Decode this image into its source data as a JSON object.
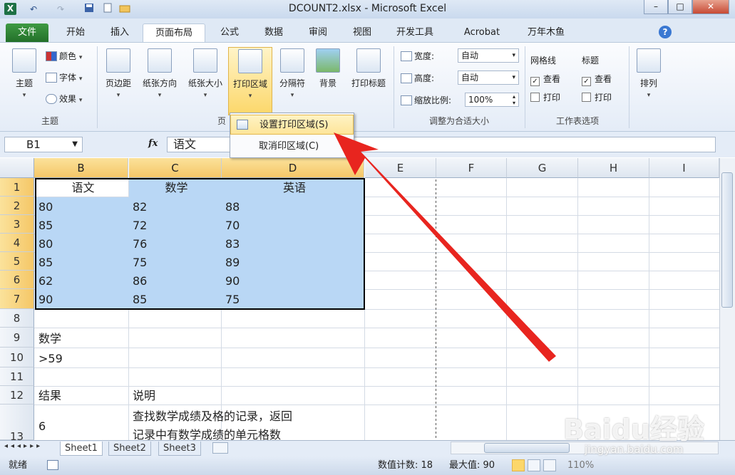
{
  "window": {
    "title": "DCOUNT2.xlsx - Microsoft Excel",
    "min": "–",
    "max": "□",
    "close": "✕"
  },
  "qat": {
    "app_icon": "X",
    "undo": "↶",
    "redo": "↷",
    "save": "💾",
    "new": "📄",
    "open": "📂"
  },
  "tabs": [
    "文件",
    "开始",
    "插入",
    "页面布局",
    "公式",
    "数据",
    "审阅",
    "视图",
    "开发工具",
    "Acrobat",
    "万年木鱼"
  ],
  "ribbon": {
    "theme": {
      "main": "主题",
      "colors": "颜色",
      "fonts": "字体",
      "effects": "效果",
      "group": "主题"
    },
    "page_setup": {
      "margins": "页边距",
      "orientation": "纸张方向",
      "size": "纸张大小",
      "print_area": "打印区域",
      "breaks": "分隔符",
      "background": "背景",
      "print_titles": "打印标题",
      "group": "页"
    },
    "scale": {
      "width_label": "宽度:",
      "width_value": "自动",
      "height_label": "高度:",
      "height_value": "自动",
      "scale_label": "缩放比例:",
      "scale_value": "100%",
      "group": "调整为合适大小"
    },
    "sheet_options": {
      "gridlines": "网格线",
      "headings": "标题",
      "view": "查看",
      "print": "打印",
      "group": "工作表选项"
    },
    "arrange": {
      "label": "排列"
    }
  },
  "menu": {
    "set_print_area": "设置打印区域(S)",
    "clear_print_area": "取消印区域(C)"
  },
  "formula_bar": {
    "name_box": "B1",
    "fx": "fx",
    "content": "语文"
  },
  "columns": [
    "B",
    "C",
    "D",
    "E",
    "F",
    "G",
    "H",
    "I"
  ],
  "rows": [
    "1",
    "2",
    "3",
    "4",
    "5",
    "6",
    "7",
    "8",
    "9",
    "10",
    "11",
    "12",
    "13"
  ],
  "cells": {
    "r1": [
      "语文",
      "数学",
      "英语"
    ],
    "r2": [
      "80",
      "82",
      "88"
    ],
    "r3": [
      "85",
      "72",
      "70"
    ],
    "r4": [
      "80",
      "76",
      "83"
    ],
    "r5": [
      "85",
      "75",
      "89"
    ],
    "r6": [
      "62",
      "86",
      "90"
    ],
    "r7": [
      "90",
      "85",
      "75"
    ],
    "b9": "数学",
    "b10": ">59",
    "b12": "结果",
    "c12": "说明",
    "b13": "6",
    "c13_line1": "查找数学成绩及格的记录，返回",
    "c13_line2": "记录中有数学成绩的单元格数"
  },
  "sheets": [
    "Sheet1",
    "Sheet2",
    "Sheet3"
  ],
  "status": {
    "ready": "就绪",
    "count": "数值计数: 18",
    "max": "最大值: 90",
    "zoom": "110%"
  },
  "watermark": {
    "brand": "Baidu经验",
    "url": "jingyan.baidu.com"
  },
  "colors": {
    "arrow": "#e8251f",
    "selection": "#b9d7f5",
    "header_selected": "#f5c767"
  }
}
